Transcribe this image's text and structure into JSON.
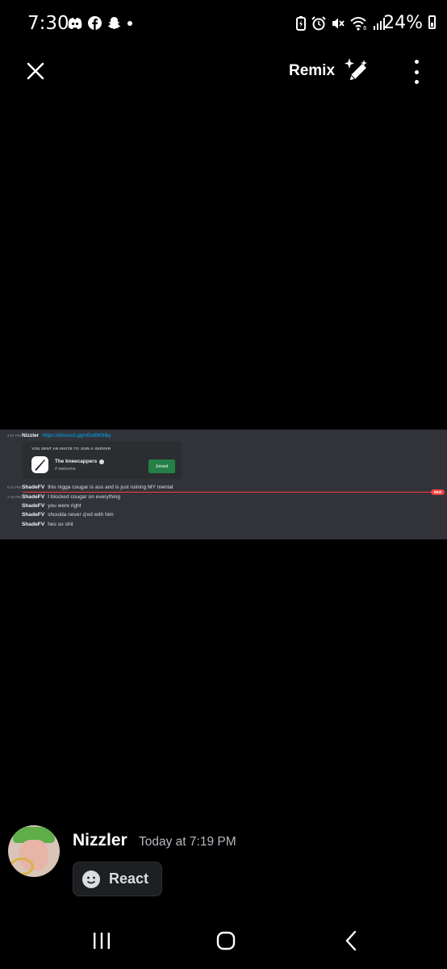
{
  "status_bar": {
    "time": "7:30",
    "left_icons": [
      "discord-icon",
      "facebook-icon",
      "snapchat-icon",
      "dot-icon"
    ],
    "right_icons": [
      "battery-saver-icon",
      "alarm-icon",
      "mute-icon",
      "wifi-6-icon",
      "signal-icon"
    ],
    "battery_percent": "24%"
  },
  "top_bar": {
    "close_icon": "close-icon",
    "remix_label": "Remix",
    "remix_icon": "sparkle-pencil-icon",
    "more_icon": "more-vertical-icon"
  },
  "screenshot": {
    "messages": [
      {
        "time": "4:57 PM",
        "author": "Nizzler",
        "text": "",
        "link": "https://discord.gg/nEwBK66q"
      },
      {
        "time": "6:44 PM",
        "author": "ShadeFV",
        "text": "this nigga cougar is ass and is just ruining MY mental",
        "link": ""
      },
      {
        "time": "7:15 PM",
        "author": "ShadeFV",
        "text": "I blocked cougar on everything",
        "link": ""
      },
      {
        "time": "",
        "author": "ShadeFV",
        "text": "you were right",
        "link": ""
      },
      {
        "time": "",
        "author": "ShadeFV",
        "text": "shoulda never q'ed with him",
        "link": ""
      },
      {
        "time": "",
        "author": "ShadeFV",
        "text": "hes so shit",
        "link": ""
      }
    ],
    "invite": {
      "heading": "YOU SENT AN INVITE TO JOIN A SERVER",
      "server_name": "The kneecappers",
      "channel": "welcome",
      "button_label": "Joined"
    },
    "new_badge": "NEW"
  },
  "author": {
    "name": "Nizzler",
    "timestamp": "Today at 7:19 PM",
    "react_label": "React"
  },
  "colors": {
    "discord_bg": "#313338",
    "link": "#00a8fc",
    "joined_button": "#248046",
    "new_marker": "#f23f43"
  }
}
